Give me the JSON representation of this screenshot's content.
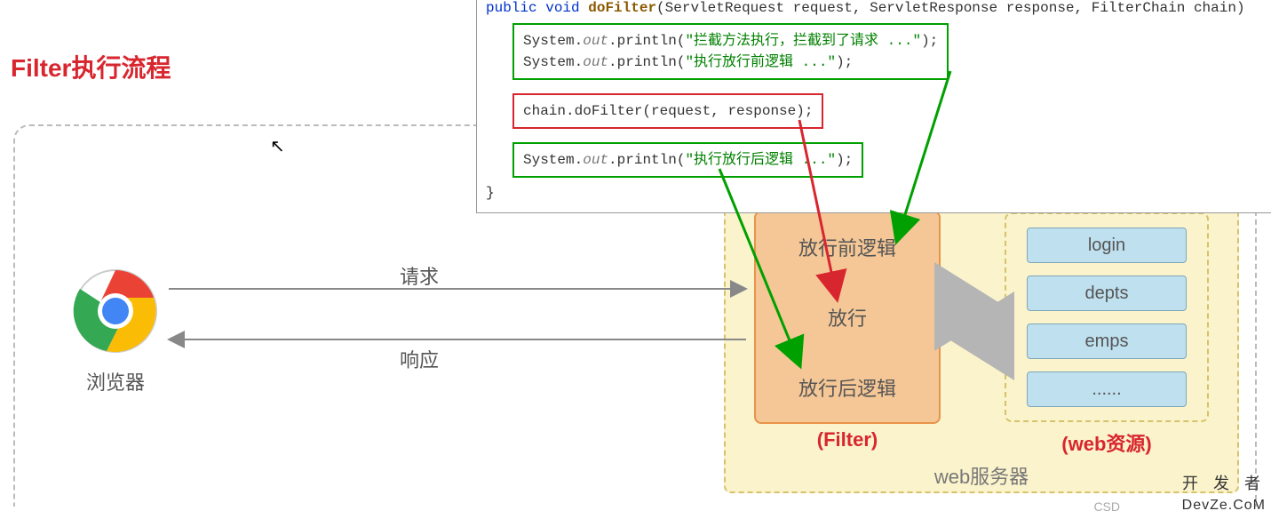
{
  "title": "Filter执行流程",
  "browser_label": "浏览器",
  "request_label": "请求",
  "response_label": "响应",
  "web_server_label": "web服务器",
  "filter": {
    "label": "(Filter)",
    "pre": "放行前逻辑",
    "doFilter": "放行",
    "post": "放行后逻辑"
  },
  "resources": {
    "label": "(web资源)",
    "items": [
      "login",
      "depts",
      "emps",
      "......"
    ]
  },
  "code": {
    "signature_public": "public",
    "signature_void": "void",
    "signature_fn": "doFilter",
    "signature_params": "(ServletRequest request, ServletResponse response, FilterChain chain)",
    "box1_line1_a": "System.",
    "box1_out": "out",
    "box1_line1_b": ".println(",
    "box1_line1_str": "\"拦截方法执行，拦截到了请求 ...\"",
    "box1_line1_c": ");",
    "box1_line2_str": "\"执行放行前逻辑 ...\"",
    "box2_text": "chain.doFilter(request, response);",
    "box3_str": "\"执行放行后逻辑 ...\""
  },
  "watermark1": "开 发 者",
  "watermark2": "DevZe.CoM",
  "csd": "CSD"
}
